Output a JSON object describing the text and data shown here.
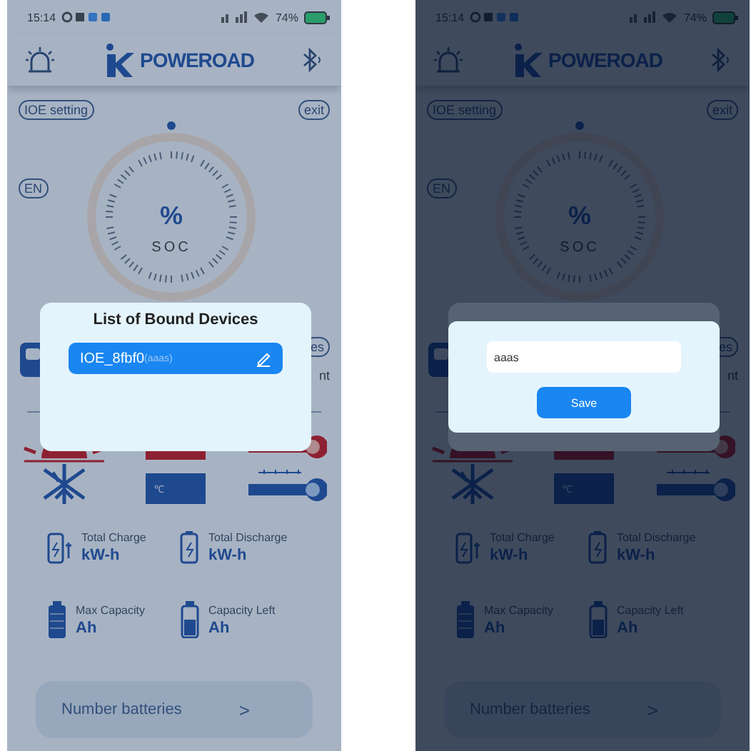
{
  "screens": [
    {
      "kind": "list",
      "status_bar": {
        "time": "15:14",
        "battery": "74%"
      },
      "header": {
        "brand": "POWEROAD"
      },
      "ioe_button": "IOE setting",
      "exit_button": "exit",
      "lang_button": "EN",
      "side_button": "es",
      "side_text": "nt",
      "gauge": {
        "value": "%",
        "label": "SOC"
      },
      "box_label": "℃",
      "stats": [
        {
          "kind": "charge",
          "label": "Total Charge",
          "unit": "kW-h"
        },
        {
          "kind": "discharge",
          "label": "Total Discharge",
          "unit": "kW-h"
        },
        {
          "kind": "full",
          "label": "Max Capacity",
          "unit": "Ah"
        },
        {
          "kind": "left",
          "label": "Capacity Left",
          "unit": "Ah"
        }
      ],
      "card": {
        "label": "Number batteries",
        "arrow": ">"
      },
      "dialog": {
        "title": "List of Bound Devices",
        "devices": [
          {
            "name": "IOE_8fbf0",
            "alias": "(aaas)"
          }
        ]
      }
    },
    {
      "kind": "rename",
      "status_bar": {
        "time": "15:14",
        "battery": "74%"
      },
      "header": {
        "brand": "POWEROAD"
      },
      "ioe_button": "IOE setting",
      "exit_button": "exit",
      "lang_button": "EN",
      "side_button": "es",
      "side_text": "nt",
      "gauge": {
        "value": "%",
        "label": "SOC"
      },
      "box_label": "℃",
      "stats": [
        {
          "kind": "charge",
          "label": "Total Charge",
          "unit": "kW-h"
        },
        {
          "kind": "discharge",
          "label": "Total Discharge",
          "unit": "kW-h"
        },
        {
          "kind": "full",
          "label": "Max Capacity",
          "unit": "Ah"
        },
        {
          "kind": "left",
          "label": "Capacity Left",
          "unit": "Ah"
        }
      ],
      "card": {
        "label": "Number batteries",
        "arrow": ">"
      },
      "rename": {
        "value": "aaas",
        "save": "Save"
      }
    }
  ]
}
